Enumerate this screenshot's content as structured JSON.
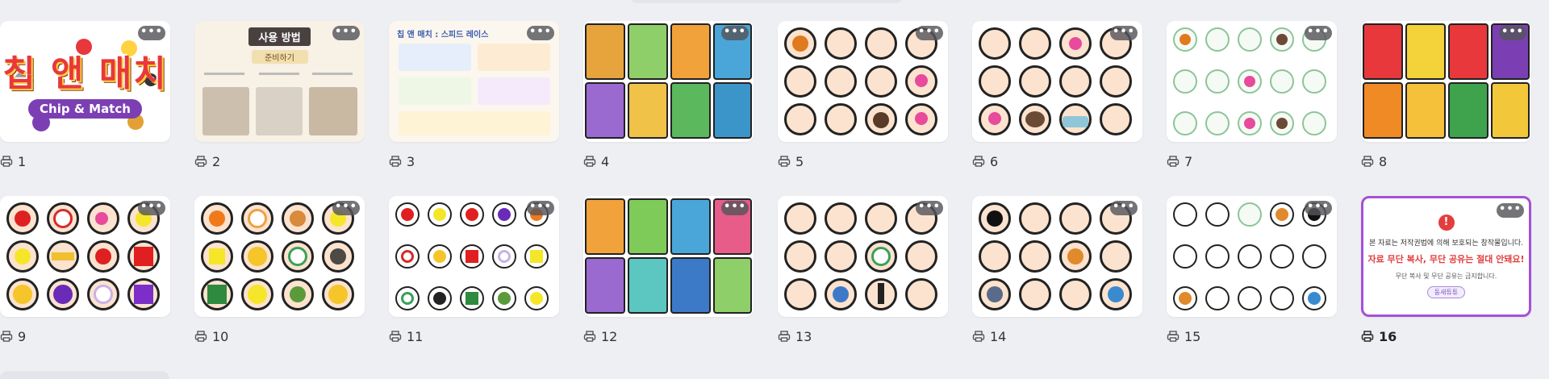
{
  "items": [
    {
      "number": "1",
      "more_label": "•••",
      "logo_text": "칩 앤 매치",
      "logo_sub": "Chip & Match"
    },
    {
      "number": "2",
      "more_label": "•••",
      "title": "사용 방법",
      "subtitle": "준비하기"
    },
    {
      "number": "3",
      "more_label": "•••",
      "title": "칩 앤 매치 : 스피드 레이스"
    },
    {
      "number": "4",
      "more_label": "•••"
    },
    {
      "number": "5",
      "more_label": "•••"
    },
    {
      "number": "6",
      "more_label": "•••"
    },
    {
      "number": "7",
      "more_label": "•••"
    },
    {
      "number": "8",
      "more_label": "•••"
    },
    {
      "number": "9",
      "more_label": "•••"
    },
    {
      "number": "10",
      "more_label": "•••"
    },
    {
      "number": "11",
      "more_label": "•••"
    },
    {
      "number": "12",
      "more_label": "•••"
    },
    {
      "number": "13",
      "more_label": "•••"
    },
    {
      "number": "14",
      "more_label": "•••"
    },
    {
      "number": "15",
      "more_label": "•••"
    },
    {
      "number": "16",
      "more_label": "•••",
      "notice_line1": "본 자료는 저작권법에 의해 보호되는 창작물입니다.",
      "notice_line2": "자료 무단 복사, 무단 공유는 절대 안돼요!",
      "notice_line3": "무단 복사 및 무단 공유는 금지합니다.",
      "notice_button": "동새튜튜"
    }
  ],
  "selected_item": "16",
  "colors": {
    "background": "#eeeff3",
    "selected_border": "#a551d6",
    "card": "#ffffff"
  },
  "icons": {
    "caption_icon": "printer-icon",
    "menu_icon": "more-dots-icon"
  }
}
